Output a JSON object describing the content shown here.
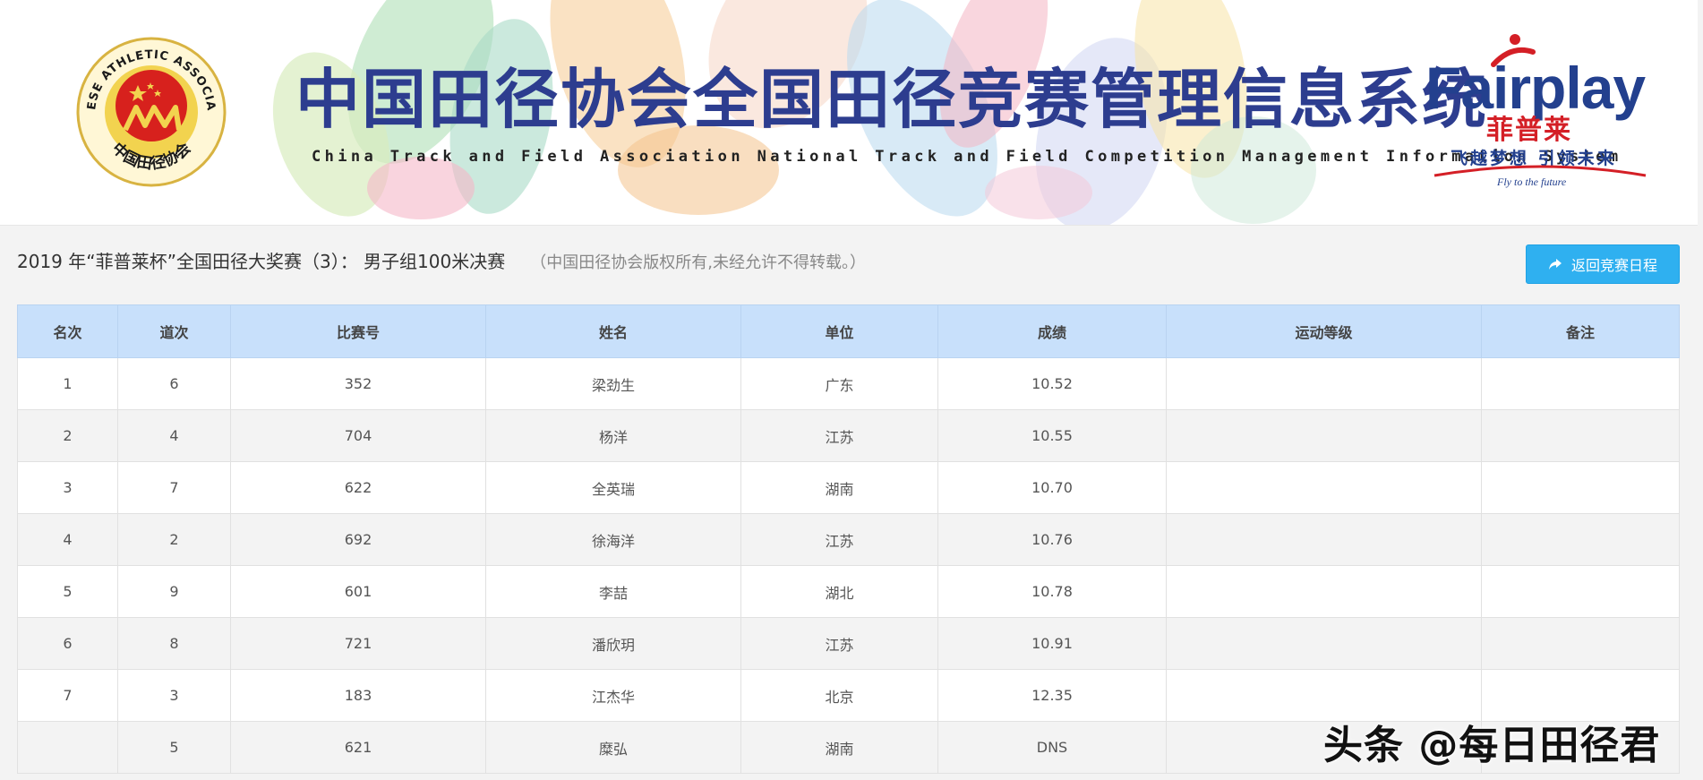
{
  "banner": {
    "title_cn": "中国田径协会全国田径竞赛管理信息系统",
    "title_en": "China Track and Field Association National Track and Field Competition Management Information System",
    "assoc_logo_text_en": "CHINESE ATHLETIC ASSOCIATION",
    "assoc_logo_text_cn": "中国田径协会",
    "sponsor": {
      "word": "Fairplay",
      "cn": "菲普莱",
      "slogan": "飞越梦想 引领未来",
      "tagline": "Fly to the future"
    }
  },
  "heading": {
    "title": "2019 年“菲普莱杯”全国田径大奖赛（3）： 男子组100米决赛",
    "copyright": "（中国田径协会版权所有,未经允许不得转载。）"
  },
  "back_button": {
    "label": "返回竞赛日程",
    "icon": "share-arrow-icon"
  },
  "table": {
    "columns": [
      "名次",
      "道次",
      "比赛号",
      "姓名",
      "单位",
      "成绩",
      "运动等级",
      "备注"
    ],
    "rows": [
      [
        "1",
        "6",
        "352",
        "梁劲生",
        "广东",
        "10.52",
        "",
        ""
      ],
      [
        "2",
        "4",
        "704",
        "杨洋",
        "江苏",
        "10.55",
        "",
        ""
      ],
      [
        "3",
        "7",
        "622",
        "全英瑞",
        "湖南",
        "10.70",
        "",
        ""
      ],
      [
        "4",
        "2",
        "692",
        "徐海洋",
        "江苏",
        "10.76",
        "",
        ""
      ],
      [
        "5",
        "9",
        "601",
        "李喆",
        "湖北",
        "10.78",
        "",
        ""
      ],
      [
        "6",
        "8",
        "721",
        "潘欣玥",
        "江苏",
        "10.91",
        "",
        ""
      ],
      [
        "7",
        "3",
        "183",
        "江杰华",
        "北京",
        "12.35",
        "",
        ""
      ],
      [
        "",
        "5",
        "621",
        "糜弘",
        "湖南",
        "DNS",
        "",
        ""
      ]
    ]
  },
  "watermark": "头条 @每日田径君",
  "colors": {
    "header_row": "#c8e0fb",
    "button": "#2fb0f0",
    "title_blue": "#2d3d8f",
    "brand_red": "#d41f26"
  }
}
